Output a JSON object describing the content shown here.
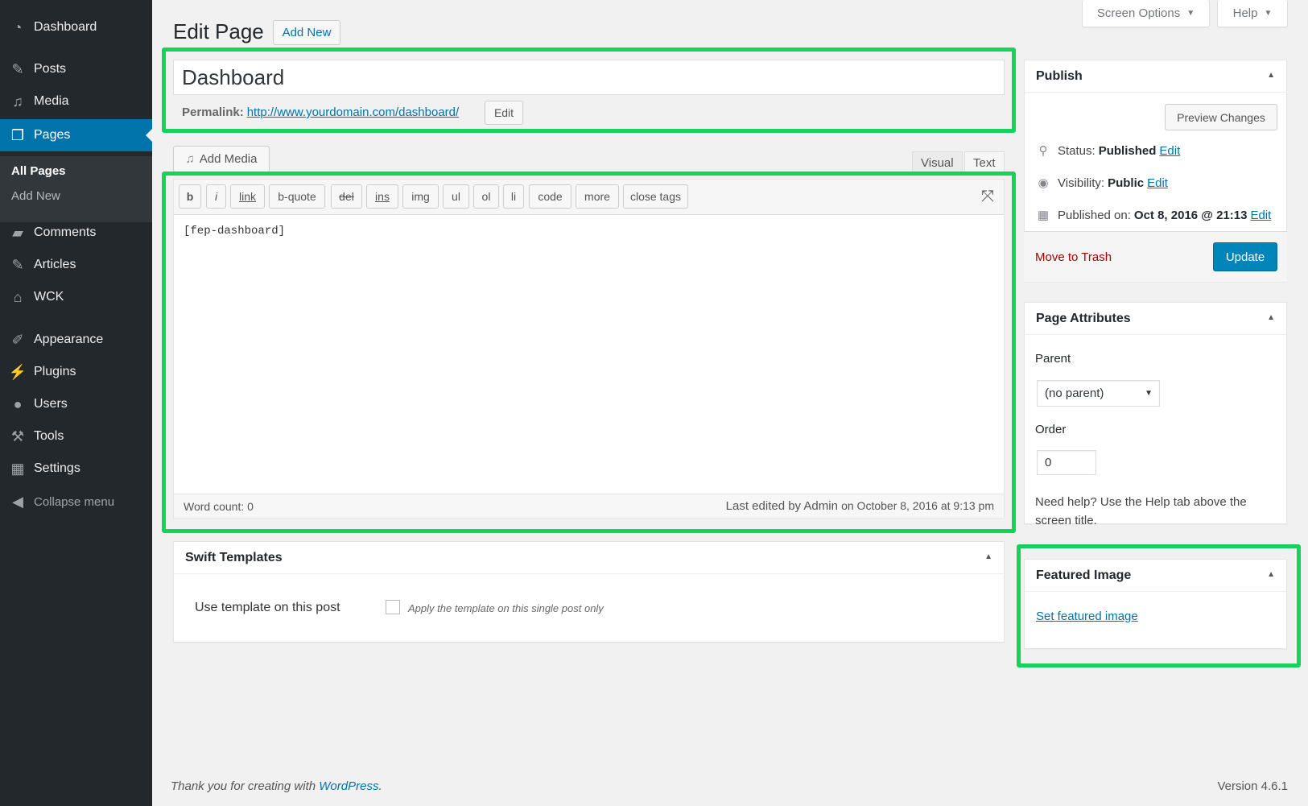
{
  "sidebar": {
    "items": [
      {
        "label": "Dashboard",
        "icon": "dashboard-icon"
      },
      {
        "label": "Posts",
        "icon": "pushpin-icon"
      },
      {
        "label": "Media",
        "icon": "media-icon"
      },
      {
        "label": "Pages",
        "icon": "pages-icon"
      },
      {
        "label": "Comments",
        "icon": "comments-icon"
      },
      {
        "label": "Articles",
        "icon": "pushpin-icon"
      },
      {
        "label": "WCK",
        "icon": "wck-icon"
      },
      {
        "label": "Appearance",
        "icon": "paintbrush-icon"
      },
      {
        "label": "Plugins",
        "icon": "plugin-icon"
      },
      {
        "label": "Users",
        "icon": "users-icon"
      },
      {
        "label": "Tools",
        "icon": "wrench-icon"
      },
      {
        "label": "Settings",
        "icon": "settings-icon"
      },
      {
        "label": "Collapse menu",
        "icon": "collapse-icon"
      }
    ],
    "submenu": [
      "All Pages",
      "Add New"
    ]
  },
  "header": {
    "title": "Edit Page",
    "add_new": "Add New",
    "screen_options": "Screen Options",
    "help": "Help"
  },
  "post": {
    "title": "Dashboard",
    "permalink_label": "Permalink:",
    "permalink_url": "http://www.yourdomain.com/dashboard/",
    "permalink_edit": "Edit"
  },
  "editor": {
    "add_media": "Add Media",
    "tab_visual": "Visual",
    "tab_text": "Text",
    "buttons": [
      "b",
      "i",
      "link",
      "b-quote",
      "del",
      "ins",
      "img",
      "ul",
      "ol",
      "li",
      "code",
      "more",
      "close tags"
    ],
    "content": "[fep-dashboard]",
    "word_count": "Word count: 0",
    "last_edited": "Last edited by Admin",
    "last_edited_date": "on October 8, 2016 at 9:13 pm"
  },
  "swift": {
    "title": "Swift Templates",
    "label": "Use template on this post",
    "checkbox_label": "Apply the template on this single post only"
  },
  "publish": {
    "title": "Publish",
    "preview": "Preview Changes",
    "status_label": "Status:",
    "status_value": "Published",
    "visibility_label": "Visibility:",
    "visibility_value": "Public",
    "published_label": "Published on:",
    "published_value": "Oct 8, 2016 @ 21:13",
    "edit": "Edit",
    "trash": "Move to Trash",
    "update": "Update"
  },
  "attributes": {
    "title": "Page Attributes",
    "parent_label": "Parent",
    "parent_value": "(no parent)",
    "order_label": "Order",
    "order_value": "0",
    "help": "Need help? Use the Help tab above the screen title."
  },
  "featured": {
    "title": "Featured Image",
    "link": "Set featured image"
  },
  "footer": {
    "thanks": "Thank you for creating with",
    "wordpress": "WordPress",
    "version": "Version 4.6.1"
  },
  "colors": {
    "accent": "#0073aa",
    "highlight_box": "#16d15c",
    "sidebar": "#23282d"
  }
}
